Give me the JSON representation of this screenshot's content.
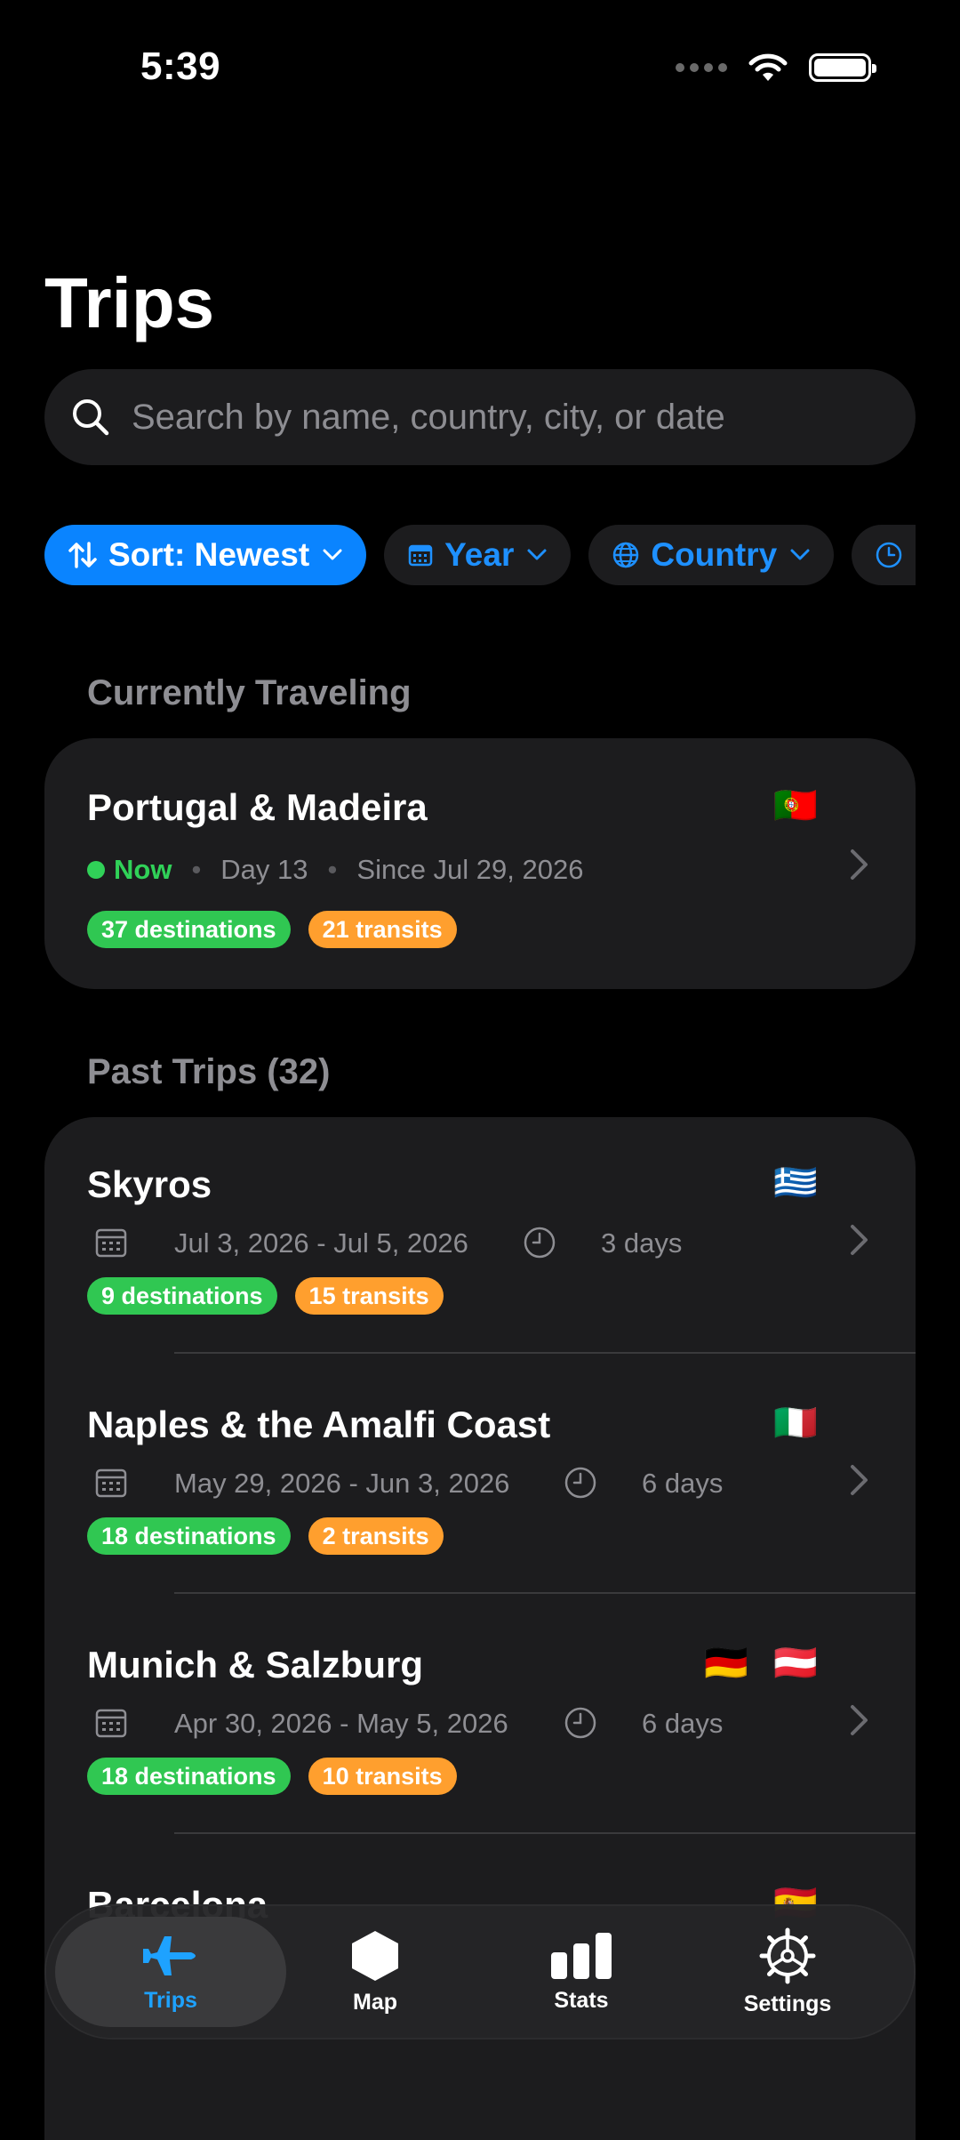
{
  "status_bar": {
    "time": "5:39"
  },
  "header": {
    "title": "Trips"
  },
  "search": {
    "placeholder": "Search by name, country, city, or date"
  },
  "filters": {
    "sort_label": "Sort: Newest",
    "year_label": "Year",
    "country_label": "Country"
  },
  "current": {
    "section_label": "Currently Traveling",
    "trip": {
      "name": "Portugal & Madeira",
      "flags": [
        "🇵🇹"
      ],
      "status": "Now",
      "day": "Day 13",
      "since": "Since Jul 29, 2026",
      "destinations": "37 destinations",
      "transits": "21 transits"
    }
  },
  "past": {
    "section_label": "Past Trips (32)",
    "trips": [
      {
        "name": "Skyros",
        "flags": [
          "🇬🇷"
        ],
        "dates": "Jul 3, 2026 - Jul 5, 2026",
        "duration": "3 days",
        "destinations": "9 destinations",
        "transits": "15 transits"
      },
      {
        "name": "Naples & the Amalfi Coast",
        "flags": [
          "🇮🇹"
        ],
        "dates": "May 29, 2026 - Jun 3, 2026",
        "duration": "6 days",
        "destinations": "18 destinations",
        "transits": "2 transits"
      },
      {
        "name": "Munich & Salzburg",
        "flags": [
          "🇩🇪",
          "🇦🇹"
        ],
        "dates": "Apr 30, 2026 - May 5, 2026",
        "duration": "6 days",
        "destinations": "18 destinations",
        "transits": "10 transits"
      },
      {
        "name": "Barcelona",
        "flags": [
          "🇪🇸"
        ]
      }
    ]
  },
  "tab_bar": {
    "trips": "Trips",
    "map": "Map",
    "stats": "Stats",
    "settings": "Settings"
  },
  "colors": {
    "accent": "#0a84ff",
    "green": "#30c752",
    "orange": "#ff9f2e",
    "card": "#1c1c1e"
  }
}
